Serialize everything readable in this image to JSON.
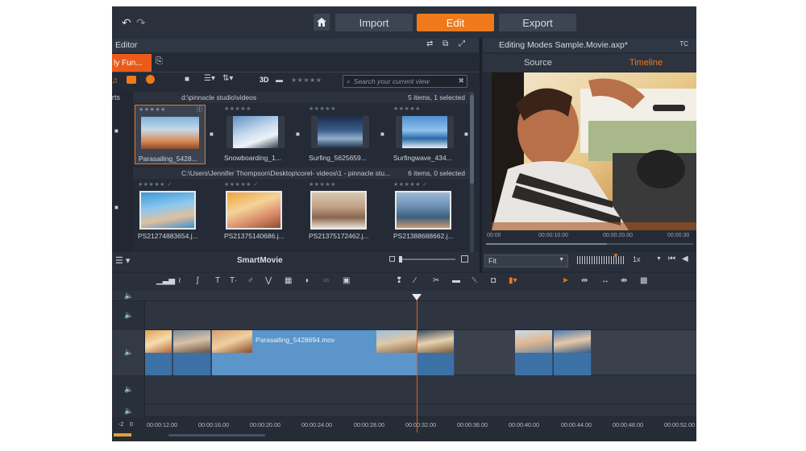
{
  "topbar": {
    "modes": [
      "Import",
      "Edit",
      "Export"
    ],
    "active_mode": "Edit"
  },
  "library": {
    "title": "Editor",
    "tab_label": "ly Fun...",
    "view_3d": "3D",
    "rating": "★★★★★",
    "search_placeholder": "Search your current view",
    "left_label": "rts",
    "folders": [
      {
        "path": "d:\\pinnacle studio\\videos",
        "summary": "5 items, 1 selected",
        "items": [
          {
            "label": "Parasailing_5428..."
          },
          {
            "label": "Snowboarding_1..."
          },
          {
            "label": "Surfing_5625659..."
          },
          {
            "label": "Surfingwave_434..."
          }
        ]
      },
      {
        "path": "C:\\Users\\Jennifer Thompson\\Desktop\\corel- videos\\1 - pinnacle stu...",
        "summary": "6 items, 0 selected",
        "items": [
          {
            "label": "PS21274883654.j..."
          },
          {
            "label": "PS21375140686.j..."
          },
          {
            "label": "PS21375172462.j..."
          },
          {
            "label": "PS21388688662.j..."
          }
        ]
      }
    ],
    "footer_title": "SmartMovie"
  },
  "preview": {
    "title": "Editing Modes Sample.Movie.axp*",
    "tc_label": "TC",
    "tabs": [
      "Source",
      "Timeline"
    ],
    "active_tab": "Timeline",
    "ruler": [
      "00:00",
      "00:00:10.00",
      "00:00:20.00",
      "00:00:30"
    ],
    "fit_label": "Fit",
    "speed_label": "1x"
  },
  "timeline": {
    "clip_label": "Parasailing_5428694.mov",
    "ruler": [
      "00:00:12.00",
      "00:00:16.00",
      "00:00:20.00",
      "00:00:24.00",
      "00:00:28.00",
      "00:00:32.00",
      "00:00:36.00",
      "00:00:40.00",
      "00:00:44.00",
      "00:00:48.00",
      "00:00:52.00"
    ],
    "level_labels": [
      "-2",
      "0"
    ]
  },
  "colors": {
    "accent": "#ee7a1b",
    "clip": "#5b95c9",
    "playhead": "#e65c1f",
    "panel": "#252b36"
  }
}
